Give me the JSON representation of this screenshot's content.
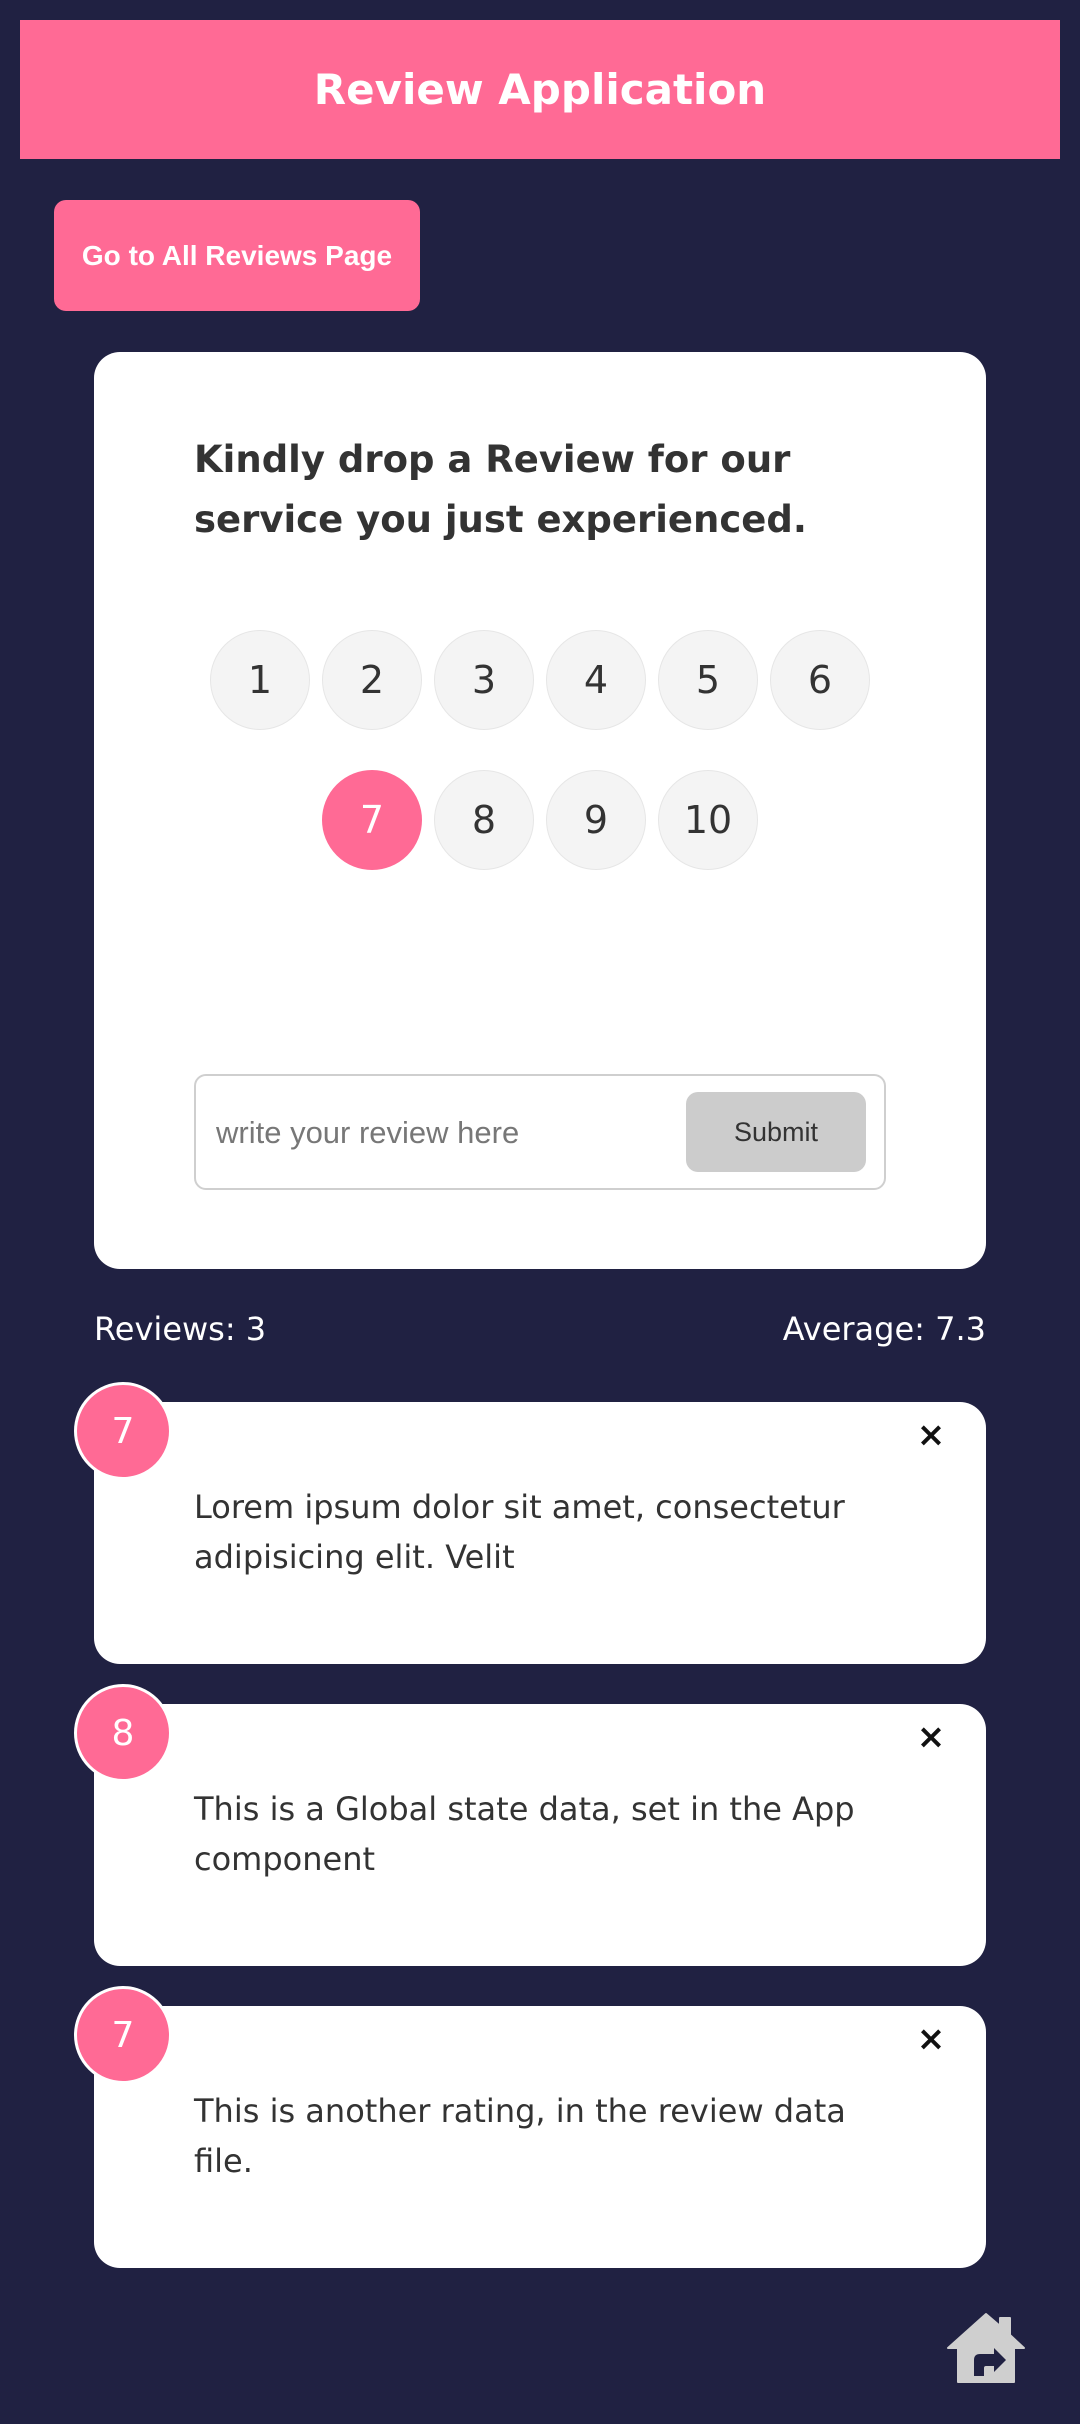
{
  "header": {
    "title": "Review Application"
  },
  "nav": {
    "all_reviews_label": "Go to All Reviews Page"
  },
  "review_form": {
    "title": "Kindly drop a Review for our service you just experienced.",
    "ratings": [
      "1",
      "2",
      "3",
      "4",
      "5",
      "6",
      "7",
      "8",
      "9",
      "10"
    ],
    "selected_rating": "7",
    "input_placeholder": "write your review here",
    "input_value": "",
    "submit_label": "Submit"
  },
  "stats": {
    "reviews_count": "Reviews: 3",
    "average": "Average: 7.3"
  },
  "reviews": [
    {
      "rating": "7",
      "text": "Lorem ipsum dolor sit amet, consectetur adipisicing elit. Velit",
      "close_label": "×"
    },
    {
      "rating": "8",
      "text": "This is a Global state data, set in the App component",
      "close_label": "×"
    },
    {
      "rating": "7",
      "text": "This is another rating, in the review data file.",
      "close_label": "×"
    }
  ],
  "icons": {
    "close": "close-icon",
    "home": "home-icon"
  },
  "colors": {
    "background": "#202142",
    "accent": "#ff6a95",
    "card": "#ffffff",
    "submit_disabled": "#cccccc"
  }
}
